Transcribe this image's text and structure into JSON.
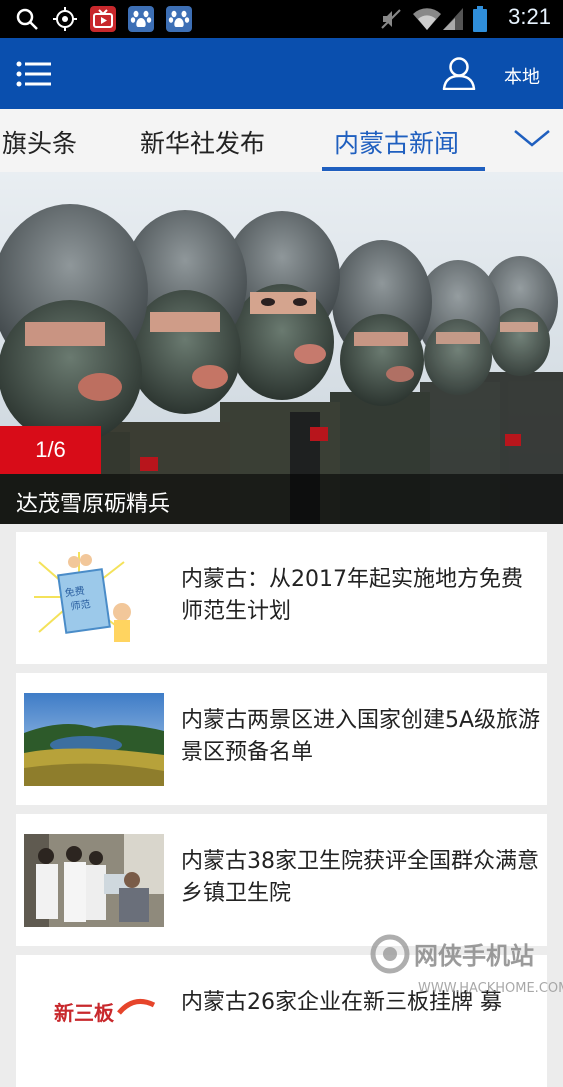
{
  "status_bar": {
    "time": "3:21",
    "icons": [
      "search-icon",
      "target-icon",
      "tv-app-icon",
      "baidu-app-icon",
      "baidu-app-icon",
      "mute-icon",
      "wifi-icon",
      "signal-icon",
      "battery-icon"
    ]
  },
  "app_bar": {
    "local_label": "本地",
    "colors": {
      "background": "#0a4fae"
    }
  },
  "tabs": [
    {
      "label": "旗头条",
      "active": false
    },
    {
      "label": "新华社发布",
      "active": false
    },
    {
      "label": "内蒙古新闻",
      "active": true
    }
  ],
  "banner": {
    "counter": "1/6",
    "caption": "达茂雪原砺精兵"
  },
  "news": [
    {
      "title": "内蒙古：从2017年起实施地方免费师范生计划"
    },
    {
      "title": "内蒙古两景区进入国家创建5A级旅游景区预备名单"
    },
    {
      "title": "内蒙古38家卫生院获评全国群众满意乡镇卫生院"
    },
    {
      "title": "内蒙古26家企业在新三板挂牌 募",
      "thumb_text": "新三板"
    }
  ],
  "watermark": {
    "name": "网侠手机站",
    "url": "WWW.HACKHOME.COM"
  }
}
